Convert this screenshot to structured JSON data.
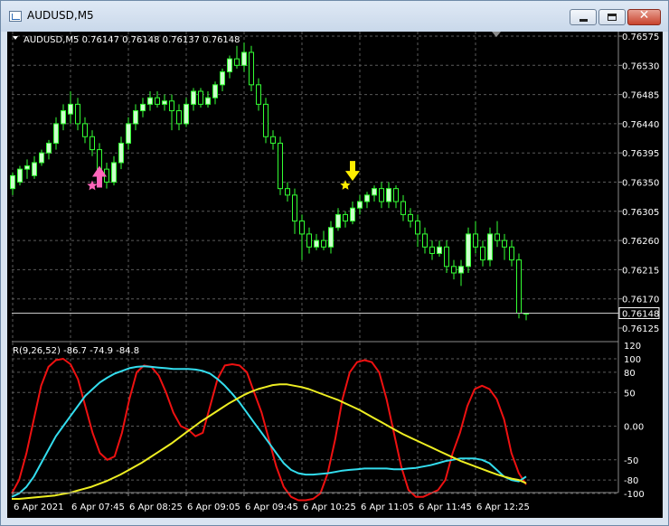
{
  "window": {
    "title": "AUDUSD,M5",
    "icon": "chart-window-icon",
    "controls": {
      "minimize": "minimize-icon",
      "maximize": "maximize-icon",
      "close_glyph": "✕"
    }
  },
  "main_chart": {
    "header": "AUDUSD,M5  0.76147 0.76148 0.76137 0.76148",
    "price_axis_labels": [
      "0.76575",
      "0.76530",
      "0.76485",
      "0.76440",
      "0.76395",
      "0.76350",
      "0.76305",
      "0.76260",
      "0.76215",
      "0.76170",
      "0.76125"
    ],
    "current_price_label": "0.76148",
    "colors": {
      "background": "#000000",
      "grid": "#5a5a5a",
      "candle": "#33ff33",
      "bull_body": "#ccffcc",
      "bear_body": "#000000",
      "buy_signal": "#ff66bb",
      "sell_signal": "#ffee00"
    }
  },
  "indicator": {
    "header": "R(9,26,52) -86.7 -74.9 -84.8",
    "axis_labels": [
      "120",
      "100",
      "80",
      "50",
      "0.00",
      "-50",
      "-80",
      "-100"
    ],
    "colors": {
      "fast": "#ee1111",
      "medium": "#33ddee",
      "slow": "#eeee22"
    }
  },
  "time_axis_labels": [
    "6 Apr 2021",
    "6 Apr 07:45",
    "6 Apr 08:25",
    "6 Apr 09:05",
    "6 Apr 09:45",
    "6 Apr 10:25",
    "6 Apr 11:05",
    "6 Apr 11:45",
    "6 Apr 12:25"
  ],
  "chart_data": [
    {
      "type": "candlestick",
      "title": "AUDUSD,M5",
      "x_labels": [
        "6 Apr 2021",
        "6 Apr 07:45",
        "6 Apr 08:25",
        "6 Apr 09:05",
        "6 Apr 09:45",
        "6 Apr 10:25",
        "6 Apr 11:05",
        "6 Apr 11:45",
        "6 Apr 12:25"
      ],
      "ylim": [
        0.76115,
        0.76585
      ],
      "grid": true,
      "candles": [
        [
          0.7634,
          0.7636,
          0.7633,
          0.76365
        ],
        [
          0.7635,
          0.7637,
          0.76345,
          0.76375
        ],
        [
          0.7637,
          0.76375,
          0.76355,
          0.76385
        ],
        [
          0.7636,
          0.7638,
          0.76355,
          0.7639
        ],
        [
          0.7638,
          0.76395,
          0.76375,
          0.764
        ],
        [
          0.76395,
          0.7641,
          0.76385,
          0.76415
        ],
        [
          0.7641,
          0.7644,
          0.764,
          0.7645
        ],
        [
          0.7644,
          0.7646,
          0.7643,
          0.7647
        ],
        [
          0.76455,
          0.7647,
          0.7644,
          0.7649
        ],
        [
          0.7647,
          0.7644,
          0.7643,
          0.7648
        ],
        [
          0.7644,
          0.7642,
          0.7641,
          0.7645
        ],
        [
          0.7642,
          0.764,
          0.7639,
          0.7643
        ],
        [
          0.764,
          0.7637,
          0.7636,
          0.7641
        ],
        [
          0.7637,
          0.7635,
          0.7634,
          0.7638
        ],
        [
          0.7635,
          0.7638,
          0.76345,
          0.7639
        ],
        [
          0.7638,
          0.7641,
          0.7637,
          0.7642
        ],
        [
          0.7641,
          0.7644,
          0.764,
          0.7645
        ],
        [
          0.7644,
          0.7646,
          0.7643,
          0.7647
        ],
        [
          0.7646,
          0.7647,
          0.7645,
          0.7648
        ],
        [
          0.7647,
          0.7648,
          0.7646,
          0.7649
        ],
        [
          0.7648,
          0.7647,
          0.76465,
          0.7649
        ],
        [
          0.7647,
          0.76475,
          0.7646,
          0.76485
        ],
        [
          0.76475,
          0.7646,
          0.7643,
          0.76485
        ],
        [
          0.7646,
          0.7644,
          0.7643,
          0.7647
        ],
        [
          0.7644,
          0.7647,
          0.76435,
          0.7648
        ],
        [
          0.7647,
          0.7649,
          0.7646,
          0.76495
        ],
        [
          0.7649,
          0.7647,
          0.76465,
          0.76495
        ],
        [
          0.7647,
          0.7648,
          0.76465,
          0.7649
        ],
        [
          0.7648,
          0.765,
          0.7647,
          0.76505
        ],
        [
          0.765,
          0.7652,
          0.7649,
          0.76525
        ],
        [
          0.7652,
          0.7654,
          0.7651,
          0.76545
        ],
        [
          0.7654,
          0.7653,
          0.76525,
          0.7656
        ],
        [
          0.7653,
          0.7655,
          0.7652,
          0.76565
        ],
        [
          0.7655,
          0.765,
          0.7649,
          0.7656
        ],
        [
          0.765,
          0.7647,
          0.7646,
          0.7651
        ],
        [
          0.7647,
          0.7642,
          0.7641,
          0.7648
        ],
        [
          0.7642,
          0.7641,
          0.764,
          0.7643
        ],
        [
          0.7641,
          0.7634,
          0.7633,
          0.7642
        ],
        [
          0.7634,
          0.7633,
          0.7632,
          0.7635
        ],
        [
          0.7633,
          0.7629,
          0.7627,
          0.7634
        ],
        [
          0.7629,
          0.7627,
          0.7623,
          0.763
        ],
        [
          0.7627,
          0.7625,
          0.7624,
          0.7628
        ],
        [
          0.7625,
          0.7626,
          0.76245,
          0.7627
        ],
        [
          0.7626,
          0.7625,
          0.76245,
          0.76275
        ],
        [
          0.7625,
          0.7628,
          0.7624,
          0.7629
        ],
        [
          0.7628,
          0.763,
          0.76275,
          0.7631
        ],
        [
          0.763,
          0.7629,
          0.7628,
          0.76305
        ],
        [
          0.7629,
          0.7631,
          0.76285,
          0.7632
        ],
        [
          0.7631,
          0.7632,
          0.763,
          0.7633
        ],
        [
          0.7632,
          0.7633,
          0.7631,
          0.76335
        ],
        [
          0.7633,
          0.7634,
          0.7632,
          0.76345
        ],
        [
          0.7634,
          0.7632,
          0.7631,
          0.7635
        ],
        [
          0.7632,
          0.7634,
          0.7631,
          0.7635
        ],
        [
          0.7634,
          0.7632,
          0.7631,
          0.76345
        ],
        [
          0.7632,
          0.763,
          0.7629,
          0.7633
        ],
        [
          0.763,
          0.7629,
          0.7628,
          0.7631
        ],
        [
          0.7629,
          0.7627,
          0.7625,
          0.763
        ],
        [
          0.7627,
          0.7625,
          0.7624,
          0.7628
        ],
        [
          0.7625,
          0.7624,
          0.7623,
          0.7626
        ],
        [
          0.7624,
          0.7625,
          0.76235,
          0.7626
        ],
        [
          0.7625,
          0.7622,
          0.7621,
          0.7626
        ],
        [
          0.7622,
          0.7621,
          0.762,
          0.7623
        ],
        [
          0.7621,
          0.7622,
          0.7619,
          0.7623
        ],
        [
          0.7622,
          0.7627,
          0.7621,
          0.7628
        ],
        [
          0.7627,
          0.7625,
          0.7624,
          0.7629
        ],
        [
          0.7625,
          0.7623,
          0.7622,
          0.7626
        ],
        [
          0.7623,
          0.7627,
          0.7622,
          0.7628
        ],
        [
          0.7627,
          0.7626,
          0.7625,
          0.7629
        ],
        [
          0.7626,
          0.7625,
          0.7623,
          0.7627
        ],
        [
          0.7625,
          0.7623,
          0.7622,
          0.7626
        ],
        [
          0.7623,
          0.76148,
          0.7614,
          0.7624
        ],
        [
          0.76147,
          0.76148,
          0.76137,
          0.76148
        ]
      ],
      "signals": [
        {
          "kind": "buy",
          "candle_index": 12,
          "price": 0.7635
        },
        {
          "kind": "sell",
          "candle_index": 47,
          "price": 0.76345
        }
      ],
      "current_price": 0.76148
    },
    {
      "type": "line",
      "title": "R(9,26,52)",
      "ylim": [
        -120,
        120
      ],
      "grid": true,
      "series": [
        {
          "name": "fast",
          "values": [
            -100,
            -80,
            -40,
            10,
            60,
            88,
            98,
            100,
            92,
            70,
            30,
            -10,
            -40,
            -50,
            -45,
            -10,
            40,
            80,
            90,
            88,
            75,
            50,
            20,
            0,
            -5,
            -15,
            -10,
            30,
            70,
            90,
            92,
            90,
            80,
            50,
            20,
            -20,
            -60,
            -90,
            -105,
            -110,
            -110,
            -108,
            -100,
            -70,
            -20,
            40,
            80,
            95,
            98,
            95,
            80,
            40,
            -10,
            -60,
            -95,
            -105,
            -105,
            -100,
            -95,
            -80,
            -40,
            -10,
            30,
            55,
            60,
            55,
            40,
            10,
            -40,
            -70,
            -86.7
          ]
        },
        {
          "name": "medium",
          "values": [
            -105,
            -100,
            -90,
            -75,
            -55,
            -35,
            -15,
            0,
            15,
            30,
            45,
            55,
            65,
            72,
            78,
            82,
            86,
            88,
            89,
            88,
            87,
            86,
            85,
            85,
            85,
            84,
            82,
            78,
            70,
            60,
            48,
            35,
            20,
            5,
            -10,
            -25,
            -40,
            -55,
            -65,
            -70,
            -72,
            -72,
            -71,
            -70,
            -68,
            -66,
            -65,
            -64,
            -63,
            -63,
            -63,
            -63,
            -64,
            -64,
            -63,
            -62,
            -60,
            -58,
            -55,
            -52,
            -50,
            -48,
            -48,
            -48,
            -50,
            -55,
            -65,
            -75,
            -80,
            -82,
            -74.9
          ]
        },
        {
          "name": "slow",
          "values": [
            -108,
            -108,
            -107,
            -106,
            -105,
            -104,
            -103,
            -101,
            -99,
            -96,
            -93,
            -90,
            -86,
            -82,
            -77,
            -72,
            -66,
            -60,
            -54,
            -47,
            -40,
            -33,
            -26,
            -18,
            -10,
            -2,
            6,
            13,
            20,
            27,
            34,
            40,
            46,
            51,
            55,
            58,
            61,
            62,
            62,
            60,
            58,
            55,
            51,
            47,
            43,
            39,
            34,
            29,
            24,
            18,
            12,
            6,
            0,
            -6,
            -12,
            -17,
            -22,
            -27,
            -32,
            -37,
            -42,
            -47,
            -52,
            -56,
            -60,
            -64,
            -68,
            -72,
            -75,
            -78,
            -80,
            -84.8
          ]
        }
      ]
    }
  ]
}
